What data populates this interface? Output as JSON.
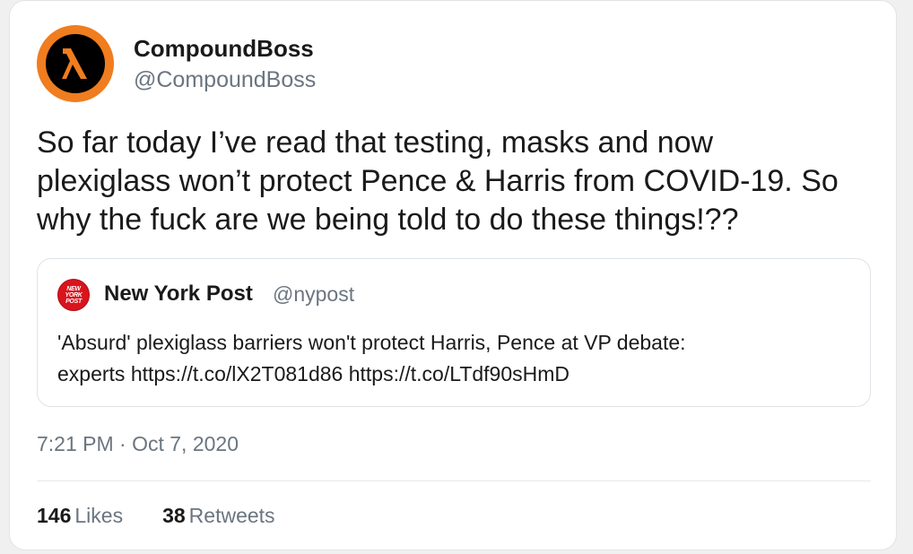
{
  "author": {
    "display_name": "CompoundBoss",
    "handle": "@CompoundBoss",
    "avatar_icon": "lambda-logo-icon",
    "avatar_color": "#f07d1f"
  },
  "tweet": {
    "text_lines": [
      "So far today I’ve read that testing, masks and now",
      "plexiglass won’t protect Pence & Harris from COVID-19. So",
      "why the fuck are we being told to do these things!??"
    ]
  },
  "quote": {
    "avatar_lines": [
      "NEW",
      "YORK",
      "POST"
    ],
    "avatar_color": "#d9141c",
    "display_name": "New York Post",
    "handle": "@nypost",
    "text_lines": [
      "'Absurd' plexiglass barriers won't protect Harris, Pence at VP debate:",
      "experts https://t.co/lX2T081d86 https://t.co/LTdf90sHmD"
    ]
  },
  "meta": {
    "timestamp": "7:21 PM · Oct 7, 2020"
  },
  "stats": {
    "likes_count": "146",
    "likes_label": "Likes",
    "retweets_count": "38",
    "retweets_label": "Retweets"
  }
}
